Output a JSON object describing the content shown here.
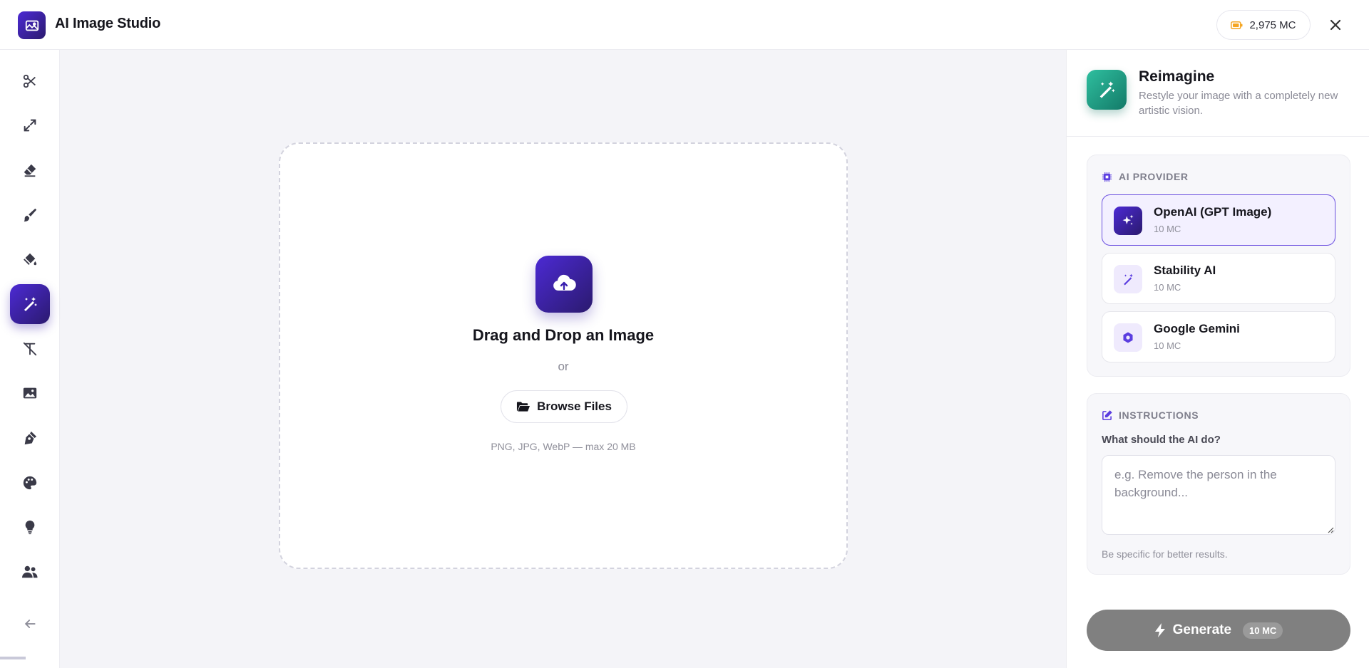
{
  "app": {
    "title": "AI Image Studio",
    "logo_icon": "image-icon"
  },
  "credits": {
    "amount": "2,975 MC",
    "icon": "battery-icon",
    "color": "#f5a623"
  },
  "sidebar": {
    "items": [
      {
        "name": "scissors-icon"
      },
      {
        "name": "expand-icon"
      },
      {
        "name": "eraser-icon"
      },
      {
        "name": "brush-icon"
      },
      {
        "name": "paint-bucket-icon"
      },
      {
        "name": "magic-wand-icon",
        "active": true
      },
      {
        "name": "text-remove-icon"
      },
      {
        "name": "image-icon"
      },
      {
        "name": "pen-nib-icon"
      },
      {
        "name": "palette-icon"
      },
      {
        "name": "lightbulb-icon"
      },
      {
        "name": "users-icon"
      }
    ],
    "collapse_icon": "arrow-left-icon"
  },
  "dropzone": {
    "title": "Drag and Drop an Image",
    "or": "or",
    "browse_label": "Browse Files",
    "hint": "PNG, JPG, WebP — max 20 MB"
  },
  "panel": {
    "title": "Reimagine",
    "subtitle": "Restyle your image with a completely new artistic vision.",
    "provider_label": "AI PROVIDER",
    "providers": [
      {
        "name": "OpenAI (GPT Image)",
        "cost": "10 MC",
        "selected": true
      },
      {
        "name": "Stability AI",
        "cost": "10 MC",
        "selected": false
      },
      {
        "name": "Google Gemini",
        "cost": "10 MC",
        "selected": false
      }
    ],
    "instructions_label": "INSTRUCTIONS",
    "instructions_question": "What should the AI do?",
    "instructions_placeholder": "e.g. Remove the person in the background...",
    "instructions_tip": "Be specific for better results.",
    "generate_label": "Generate",
    "generate_cost": "10 MC"
  },
  "colors": {
    "accent": "#4c2ad4",
    "accent_dark": "#2b1a6e",
    "teal": "#1f9c84",
    "generate_disabled": "#808080"
  }
}
